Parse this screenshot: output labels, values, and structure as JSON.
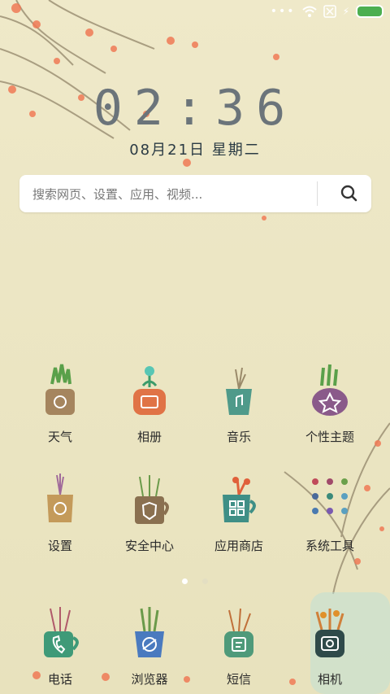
{
  "clock": {
    "time": "02:36",
    "date": "08月21日  星期二"
  },
  "search": {
    "placeholder": "搜索网页、设置、应用、视频..."
  },
  "apps_row1": [
    {
      "label": "天气"
    },
    {
      "label": "相册"
    },
    {
      "label": "音乐"
    },
    {
      "label": "个性主题"
    }
  ],
  "apps_row2": [
    {
      "label": "设置"
    },
    {
      "label": "安全中心"
    },
    {
      "label": "应用商店"
    },
    {
      "label": "系统工具"
    }
  ],
  "dock": [
    {
      "label": "电话"
    },
    {
      "label": "浏览器"
    },
    {
      "label": "短信"
    },
    {
      "label": "相机"
    }
  ],
  "pager": {
    "active_index": 0,
    "count": 2
  },
  "colors": {
    "battery": "#4caf50",
    "text": "#2a2a2a",
    "clock": "#6b747a"
  }
}
